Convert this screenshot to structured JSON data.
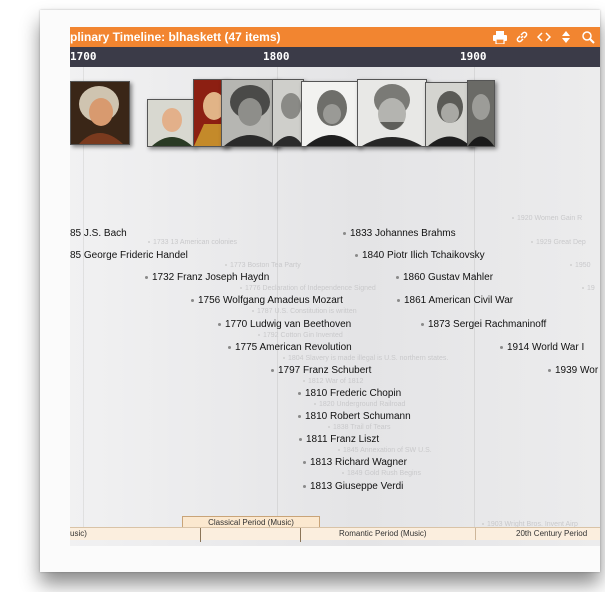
{
  "title": "plinary Timeline: blhaskett  (47 items)",
  "toolbar": {
    "icons": [
      "printer-icon",
      "link-icon",
      "scroll-horizontal-icon",
      "scroll-vertical-icon",
      "zoom-icon"
    ]
  },
  "scale": {
    "ticks": [
      "1700",
      "1800",
      "1900"
    ]
  },
  "colors": {
    "title_bar": "#f28530",
    "scale_bar": "#3b3b48",
    "period_band": "#fbeede"
  },
  "main_events": [
    "85 J.S. Bach",
    "85 George Frideric Handel",
    "1732 Franz Joseph Haydn",
    "1756 Wolfgang Amadeus Mozart",
    "1770 Ludwig van Beethoven",
    "1775 American Revolution",
    "1797 Franz Schubert",
    "1810 Frederic Chopin",
    "1810 Robert Schumann",
    "1811 Franz Liszt",
    "1813 Richard Wagner",
    "1813 Giuseppe Verdi",
    "1833 Johannes Brahms",
    "1840 Piotr Ilich Tchaikovsky",
    "1860 Gustav Mahler",
    "1861 American Civil War",
    "1873 Sergei Rachmaninoff",
    "1914 World War I",
    "1939 Wor"
  ],
  "minor_events": [
    "1733 13 American colonies",
    "1773 Boston Tea Party",
    "1776 Declaration of Independence Signed",
    "1787 U.S. Constitution is written",
    "1792 Cotton Gin Invented",
    "1804 Slavery is made illegal is U.S. northern states.",
    "1812 War of 1812",
    "1820 Underground Railroad",
    "1838 Trail of Tears",
    "1845 Annexation of SW U.S.",
    "1849 Gold Rush Begins",
    "1920 Women Gain R",
    "1929 Great Dep",
    "1950",
    "19",
    "1903 Wright Bros. Invent Airp"
  ],
  "periods": [
    "usic)",
    "Classical Period (Music)",
    "Romantic Period (Music)",
    "20th Century Period"
  ]
}
